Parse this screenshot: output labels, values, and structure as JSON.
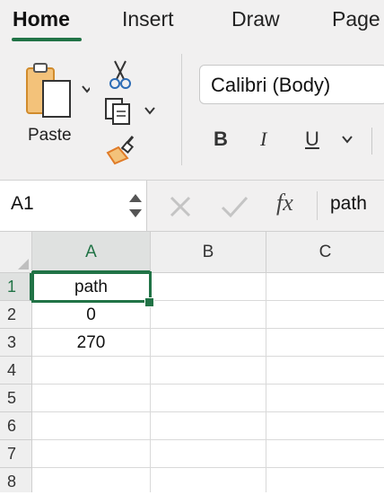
{
  "ribbon": {
    "tabs": [
      {
        "label": "Home",
        "active": true
      },
      {
        "label": "Insert",
        "active": false
      },
      {
        "label": "Draw",
        "active": false
      },
      {
        "label": "Page",
        "active": false
      }
    ],
    "clipboard": {
      "paste_label": "Paste",
      "icons": [
        "clipboard-paste-icon",
        "scissors-icon",
        "copy-icon",
        "format-painter-icon"
      ]
    },
    "font": {
      "family_value": "Calibri (Body)",
      "bold_label": "B",
      "italic_label": "I",
      "underline_label": "U"
    }
  },
  "formula_bar": {
    "name_box": "A1",
    "fx_label": "fx",
    "content": "path"
  },
  "sheet": {
    "columns": [
      "A",
      "B",
      "C"
    ],
    "rows": [
      "1",
      "2",
      "3",
      "4",
      "5",
      "6",
      "7",
      "8"
    ],
    "selected_cell": "A1",
    "cells": {
      "A1": "path",
      "A2": "0",
      "A3": "270"
    }
  },
  "colors": {
    "accent": "#217346",
    "ribbon_bg": "#f1f0f0",
    "header_bg": "#efefef"
  }
}
